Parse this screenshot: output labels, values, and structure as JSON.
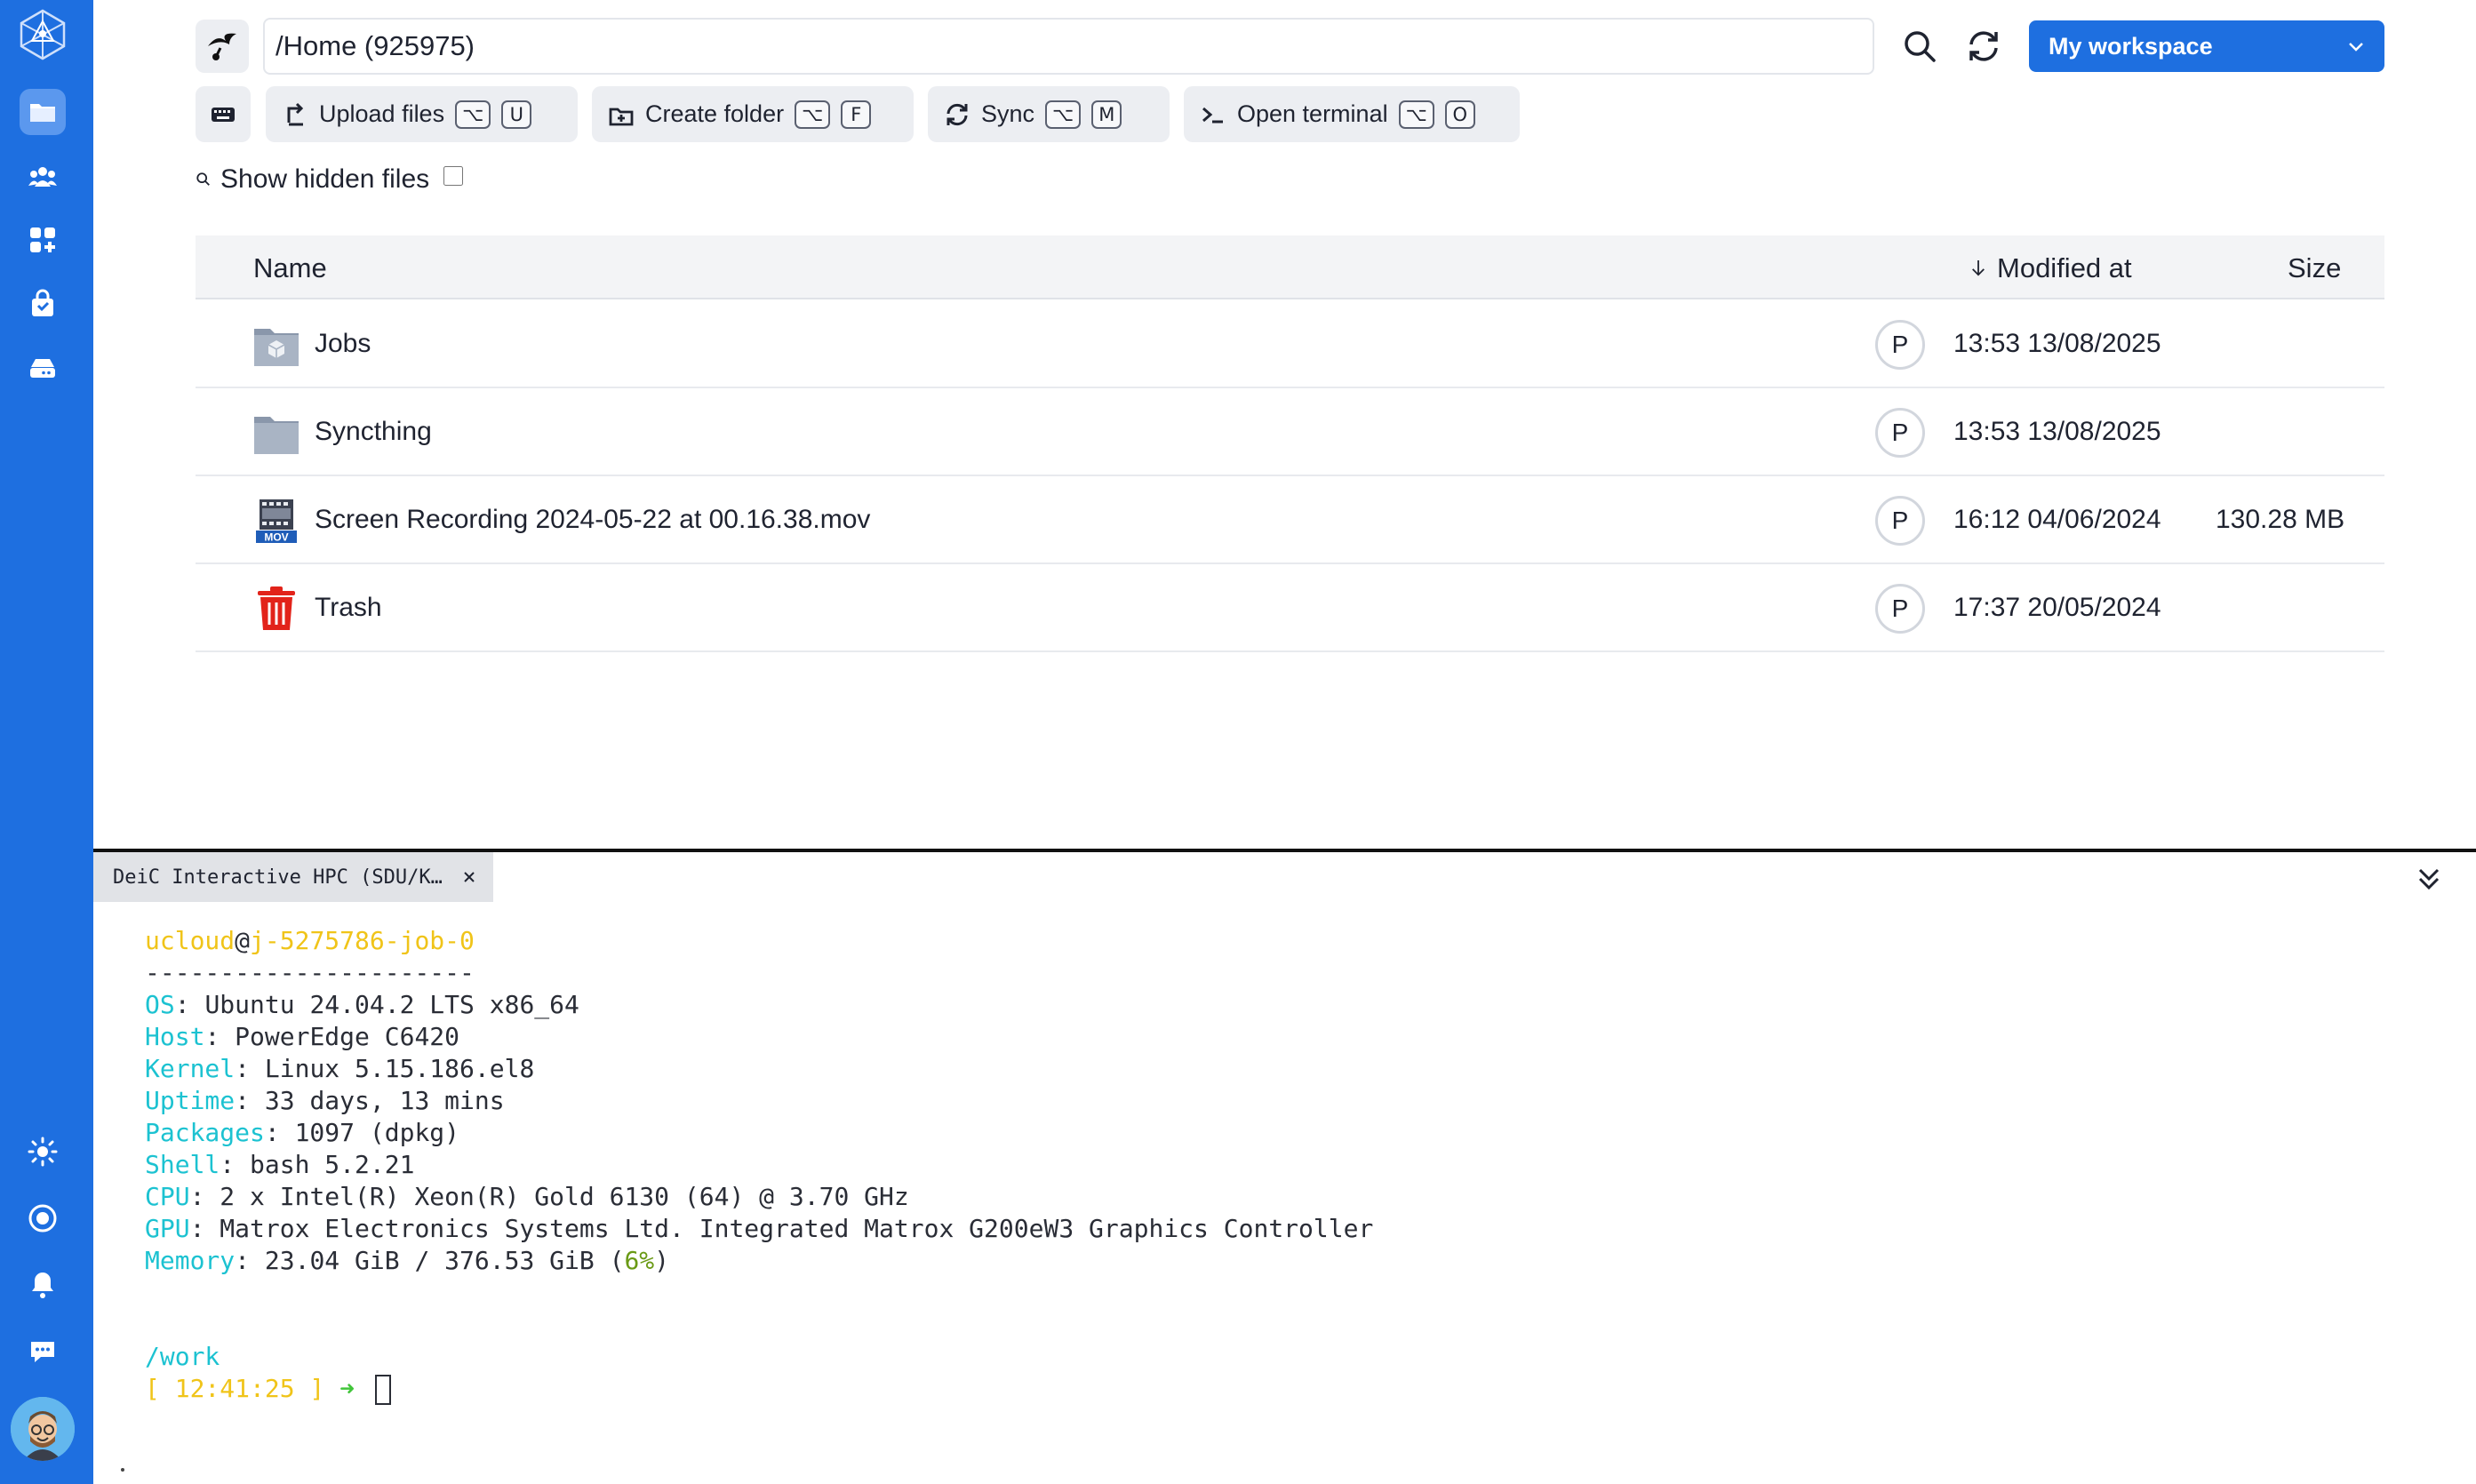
{
  "topbar": {
    "path": "/Home (925975)",
    "workspace_label": "My workspace"
  },
  "toolbar": {
    "upload_label": "Upload files",
    "upload_keys": [
      "⌥",
      "U"
    ],
    "create_folder_label": "Create folder",
    "create_folder_keys": [
      "⌥",
      "F"
    ],
    "sync_label": "Sync",
    "sync_keys": [
      "⌥",
      "M"
    ],
    "terminal_label": "Open terminal",
    "terminal_keys": [
      "⌥",
      "O"
    ]
  },
  "show_hidden_label": "Show hidden files",
  "table": {
    "col_name": "Name",
    "col_modified": "Modified at",
    "col_size": "Size",
    "rows": [
      {
        "name": "Jobs",
        "badge": "P",
        "modified": "13:53 13/08/2025",
        "size": "",
        "icon": "jobs-folder-icon"
      },
      {
        "name": "Syncthing",
        "badge": "P",
        "modified": "13:53 13/08/2025",
        "size": "",
        "icon": "folder-icon"
      },
      {
        "name": "Screen Recording 2024-05-22 at 00.16.38.mov",
        "badge": "P",
        "modified": "16:12 04/06/2024",
        "size": "130.28 MB",
        "icon": "mov-file-icon"
      },
      {
        "name": "Trash",
        "badge": "P",
        "modified": "17:37 20/05/2024",
        "size": "",
        "icon": "trash-icon"
      }
    ]
  },
  "terminal": {
    "tab_title": "DeiC Interactive HPC (SDU/K…",
    "user": "ucloud",
    "host": "j-5275786-job-0",
    "separator": "----------------------",
    "info": [
      {
        "key": "OS",
        "value": "Ubuntu 24.04.2 LTS x86_64"
      },
      {
        "key": "Host",
        "value": "PowerEdge C6420"
      },
      {
        "key": "Kernel",
        "value": "Linux 5.15.186.el8"
      },
      {
        "key": "Uptime",
        "value": "33 days, 13 mins"
      },
      {
        "key": "Packages",
        "value": "1097 (dpkg)"
      },
      {
        "key": "Shell",
        "value": "bash 5.2.21"
      },
      {
        "key": "CPU",
        "value": "2 x Intel(R) Xeon(R) Gold 6130 (64) @ 3.70 GHz"
      },
      {
        "key": "GPU",
        "value": "Matrox Electronics Systems Ltd. Integrated Matrox G200eW3 Graphics Controller"
      }
    ],
    "memory_key": "Memory",
    "memory_value": "23.04 GiB / 376.53 GiB (",
    "memory_pct": "6%",
    "memory_close": ")",
    "cwd": "/work",
    "prompt_time": "[ 12:41:25 ]",
    "prompt_arrow": "➜"
  },
  "colors": {
    "accent": "#1e6fe0",
    "rail_active": "#5b98ee",
    "term_yellow": "#f0c419",
    "term_cyan": "#1cc2d1",
    "trash_red": "#e2231a"
  }
}
